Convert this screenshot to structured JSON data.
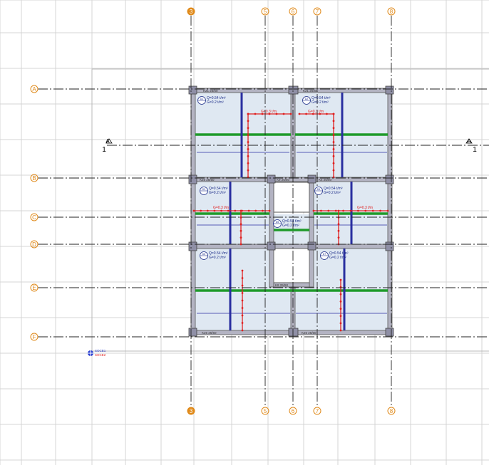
{
  "axes": {
    "vertical": [
      {
        "label": "3",
        "key": "v3"
      },
      {
        "label": "5",
        "key": "v5"
      },
      {
        "label": "6",
        "key": "v6"
      },
      {
        "label": "7",
        "key": "v7"
      },
      {
        "label": "8",
        "key": "v8"
      }
    ],
    "horizontal": [
      {
        "label": "A",
        "key": "hA"
      },
      {
        "label": "B",
        "key": "hB"
      },
      {
        "label": "C",
        "key": "hC"
      },
      {
        "label": "D",
        "key": "hD"
      },
      {
        "label": "E",
        "key": "hE"
      },
      {
        "label": "F",
        "key": "hF"
      }
    ]
  },
  "section_mark": {
    "letter": "A",
    "number": "1"
  },
  "beams": {
    "top_left": "K21 25/50",
    "top_right": "K21 25/50",
    "bottom_left": "K25 25/50",
    "bottom_right": "K26 25/50",
    "core_top": "K9 25/50",
    "core_bottom": "K8 25/50",
    "left_b": "K25 25/50",
    "right_b": "K4 25/50"
  },
  "slabs": [
    {
      "id": "D1",
      "q": "Q=0.54 t/m²",
      "g": "G=0.2 t/m²"
    },
    {
      "id": "D2",
      "q": "Q=0.54 t/m²",
      "g": "G=0.2 t/m²"
    },
    {
      "id": "D3",
      "q": "Q=0.54 t/m²",
      "g": "G=0.2 t/m²"
    },
    {
      "id": "D4",
      "q": "Q=0.54 t/m²",
      "g": "G=0.2 t/m²"
    },
    {
      "id": "D5",
      "q": "Q=0.54 t/m²",
      "g": "G=0.2 t/m²"
    },
    {
      "id": "D6",
      "q": "Q=0.54 t/m²",
      "g": "G=0.2 t/m²"
    },
    {
      "id": "D7",
      "q": "Q=0.54 t/m²",
      "g": "G=0.2 t/m²"
    }
  ],
  "wall_loads": {
    "label": "G=0.3 t/m",
    "count": 6
  },
  "origin": {
    "line1": "SOCE1",
    "line2": "SOCE2"
  },
  "colors": {
    "grid": "#d4d4d4",
    "axis_bubble": "#e08a1a",
    "wall": "#a7a7b8",
    "slab": "#dfe8f2",
    "beam_green": "#1f9a2a",
    "beam_blue": "#2a2fa0",
    "load_red": "#e02020"
  }
}
